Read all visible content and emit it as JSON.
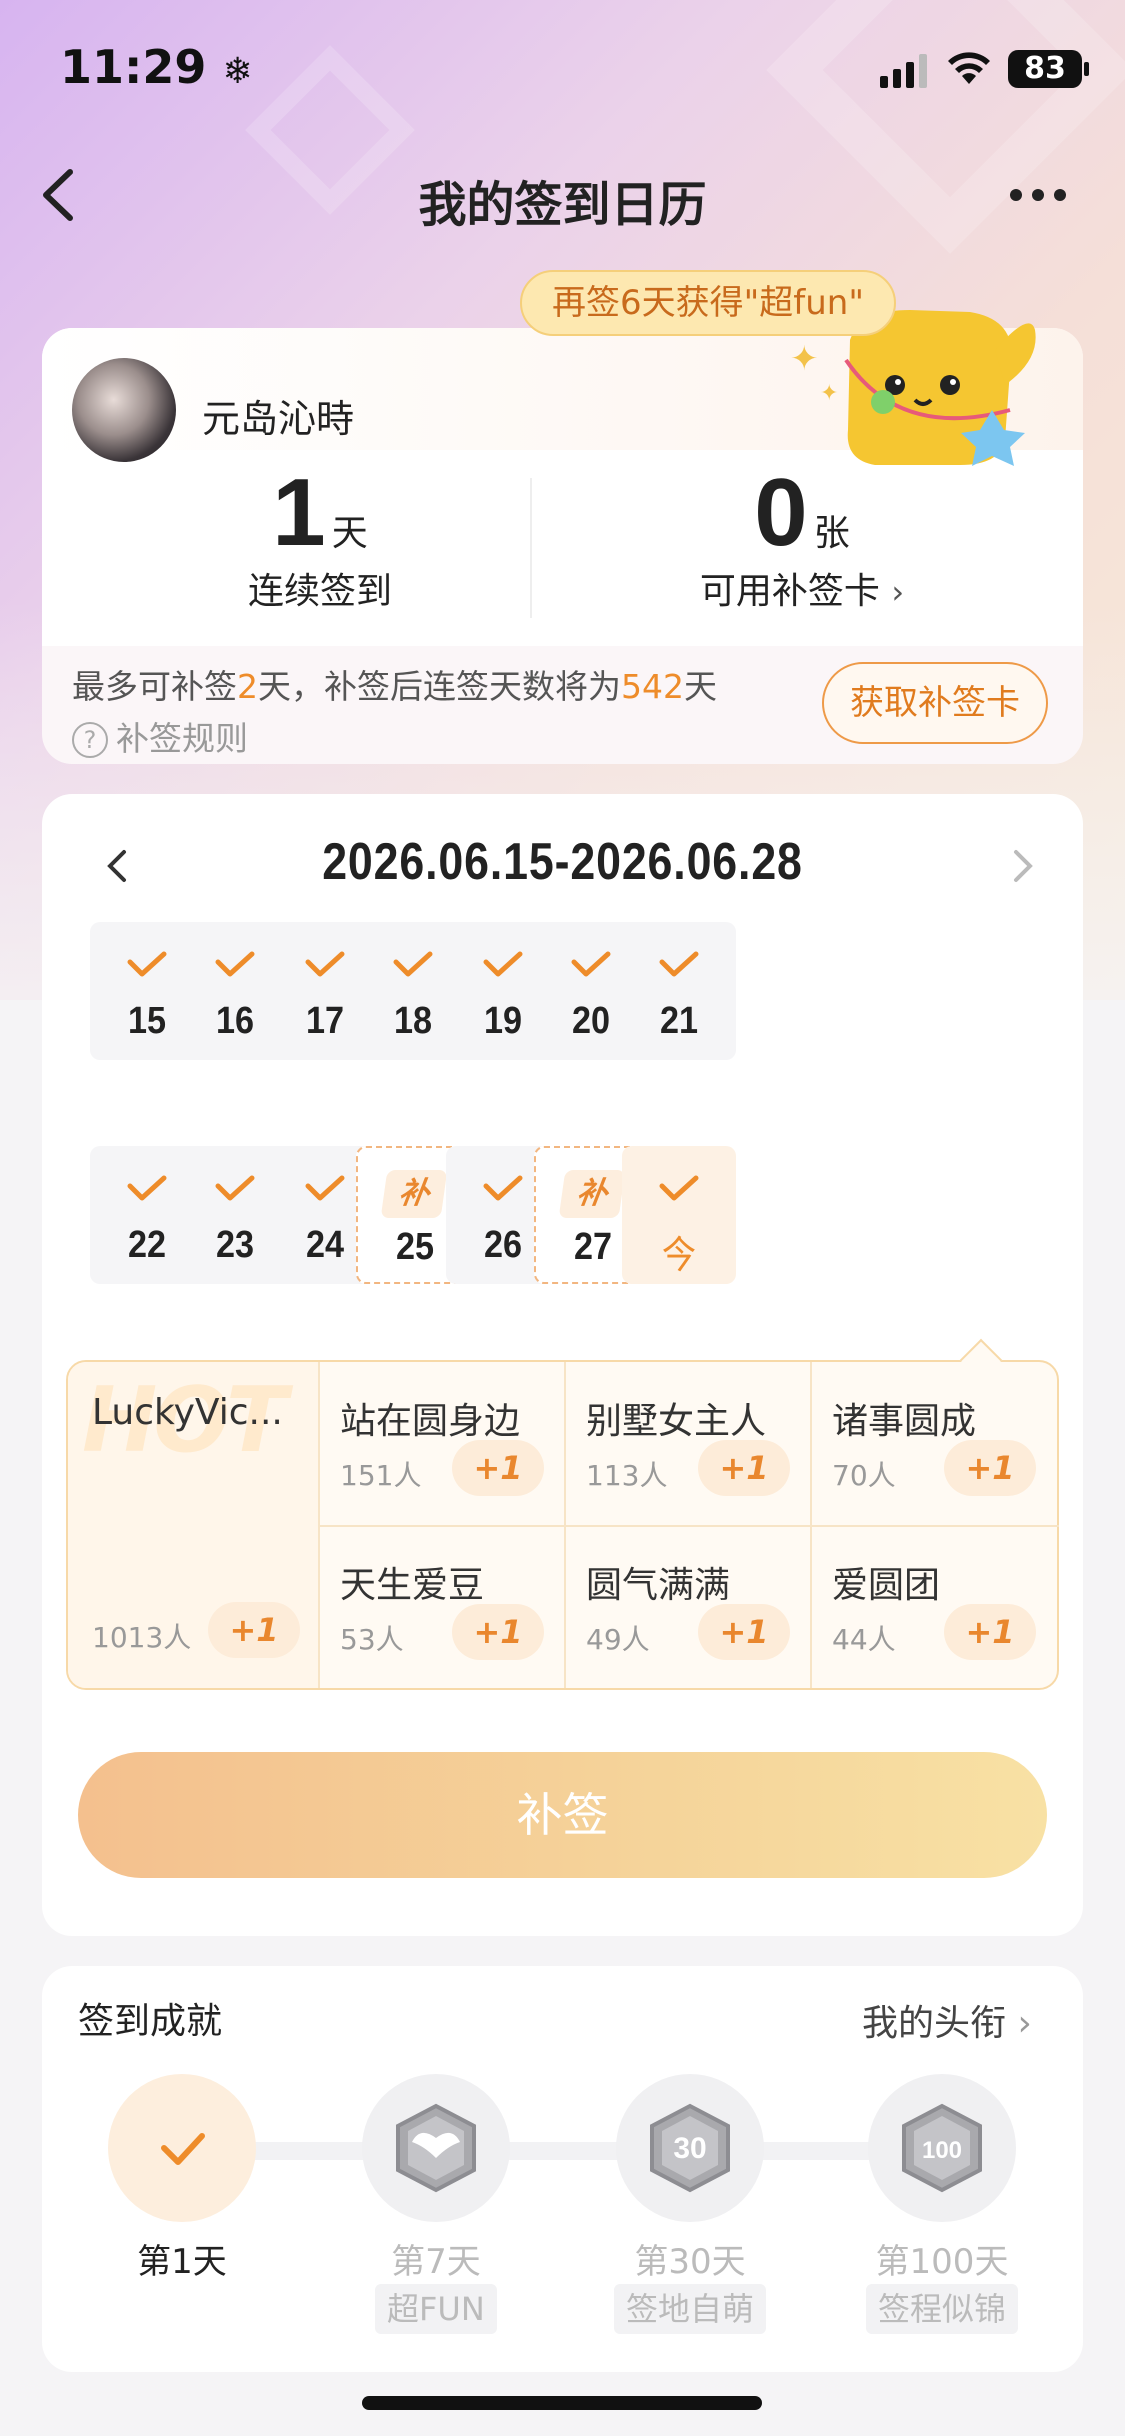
{
  "status_bar": {
    "time": "11:29",
    "battery": "83"
  },
  "header": {
    "title": "我的签到日历"
  },
  "promo": {
    "text": "再签6天获得\"超fun\""
  },
  "profile": {
    "username": "元岛沁時"
  },
  "stats": {
    "streak": {
      "value": "1",
      "unit": "天",
      "label": "连续签到"
    },
    "cards": {
      "value": "0",
      "unit": "张",
      "label": "可用补签卡"
    }
  },
  "makeup_info": {
    "prefix": "最多可补签",
    "max_days": "2",
    "middle": "天，补签后连签天数将为",
    "result_days": "542",
    "suffix": "天",
    "rule_label": "补签规则",
    "get_card_button": "获取补签卡"
  },
  "calendar": {
    "range": "2026.06.15-2026.06.28",
    "days": [
      {
        "label": "15",
        "state": "signed"
      },
      {
        "label": "16",
        "state": "signed"
      },
      {
        "label": "17",
        "state": "signed"
      },
      {
        "label": "18",
        "state": "signed"
      },
      {
        "label": "19",
        "state": "signed"
      },
      {
        "label": "20",
        "state": "signed"
      },
      {
        "label": "21",
        "state": "signed"
      },
      {
        "label": "22",
        "state": "signed"
      },
      {
        "label": "23",
        "state": "signed"
      },
      {
        "label": "24",
        "state": "signed"
      },
      {
        "label": "25",
        "state": "makeup",
        "tag": "补"
      },
      {
        "label": "26",
        "state": "signed"
      },
      {
        "label": "27",
        "state": "makeup",
        "tag": "补"
      },
      {
        "label": "今",
        "state": "today"
      }
    ]
  },
  "titles": {
    "hot_watermark": "HOT",
    "hot": {
      "name": "LuckyVic...",
      "count": "1013人",
      "plus": "+1"
    },
    "items": [
      {
        "name": "站在圆身边",
        "count": "151人",
        "plus": "+1"
      },
      {
        "name": "别墅女主人",
        "count": "113人",
        "plus": "+1"
      },
      {
        "name": "诸事圆成",
        "count": "70人",
        "plus": "+1"
      },
      {
        "name": "天生爱豆",
        "count": "53人",
        "plus": "+1"
      },
      {
        "name": "圆气满满",
        "count": "49人",
        "plus": "+1"
      },
      {
        "name": "爱圆团",
        "count": "44人",
        "plus": "+1"
      }
    ]
  },
  "makeup_button": "补签",
  "achievements": {
    "title": "签到成就",
    "link": "我的头衔",
    "milestones": [
      {
        "label": "第1天",
        "tag": "",
        "done": true,
        "icon": "check-icon"
      },
      {
        "label": "第7天",
        "tag": "超FUN",
        "done": false,
        "icon": "wings-badge-icon"
      },
      {
        "label": "第30天",
        "tag": "签地自萌",
        "done": false,
        "icon": "30-days-badge-icon",
        "badge_text": "30"
      },
      {
        "label": "第100天",
        "tag": "签程似锦",
        "done": false,
        "icon": "100-days-badge-icon",
        "badge_text": "100"
      }
    ]
  },
  "colors": {
    "accent": "#ee8c2a",
    "accent_light": "#fdeede",
    "button_gradient": [
      "#f4c08e",
      "#f8e1a4"
    ]
  }
}
